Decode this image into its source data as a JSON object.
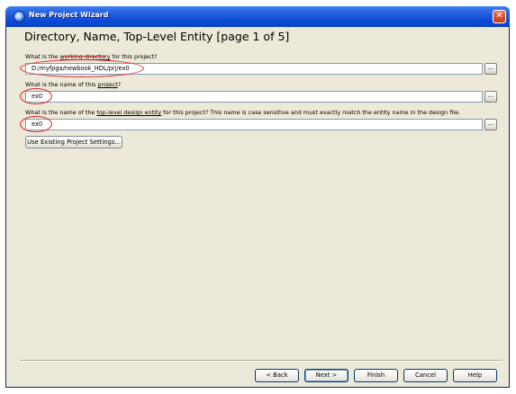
{
  "window": {
    "title": "New Project Wizard",
    "close_glyph": "✕"
  },
  "page": {
    "heading": "Directory, Name, Top-Level Entity [page 1 of 5]"
  },
  "questions": [
    {
      "label_pre": "What is the ",
      "label_underlined": "working directory",
      "label_post": " for this project?",
      "value": "D:/myfpga/newbook_HDL/prj/ex0"
    },
    {
      "label_pre": "What is the name of this ",
      "label_underlined": "project",
      "label_post": "?",
      "value": "ex0"
    },
    {
      "label_pre": "What is the name of the ",
      "label_underlined": "top-level design entity",
      "label_post": " for this project? This name is case sensitive and must exactly match the entity name in the design file.",
      "value": "ex0"
    }
  ],
  "browse_label": "...",
  "use_existing_button": "Use Existing Project Settings...",
  "footer": {
    "back": "< Back",
    "next": "Next >",
    "finish": "Finish",
    "cancel": "Cancel",
    "help": "Help"
  },
  "colors": {
    "titlebar": "#0b4bd6",
    "window_bg": "#ece9d8",
    "annotation_red": "#e0252b"
  }
}
